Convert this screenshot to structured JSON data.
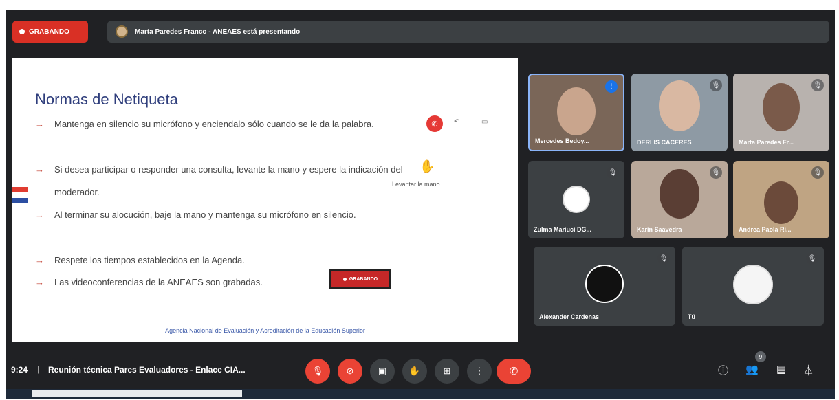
{
  "header": {
    "recording_label": "GRABANDO",
    "presenting_text": "Marta Paredes Franco - ANEAES está presentando"
  },
  "slide": {
    "title": "Normas de Netiqueta",
    "bullets": [
      "Mantenga en silencio su micrófono y enciendalo sólo cuando se le da la palabra.",
      "Si desea participar o responder una consulta, levante la mano y espere la indicación del moderador.",
      "Al terminar su alocución, baje la mano y mantenga su micrófono en silencio.",
      "Respete los tiempos establecidos en la Agenda.",
      "Las videoconferencias de la ANEAES son grabadas."
    ],
    "raise_hand_label": "Levantar la mano",
    "recording_label": "GRABANDO",
    "footer": "Agencia Nacional de Evaluación y Acreditación de la Educación Superior"
  },
  "participants": [
    {
      "name": "Mercedes Bedoy...",
      "speaking": true
    },
    {
      "name": "DERLIS CACERES",
      "speaking": false
    },
    {
      "name": "Marta Paredes Fr...",
      "speaking": false
    },
    {
      "name": "Zulma Mariuci DG...",
      "speaking": false
    },
    {
      "name": "Karin Saavedra",
      "speaking": false
    },
    {
      "name": "Andrea Paola Ri...",
      "speaking": false
    },
    {
      "name": "Alexander Cardenas",
      "speaking": false
    },
    {
      "name": "Tú",
      "speaking": false
    }
  ],
  "footer": {
    "time": "9:24",
    "meeting_title": "Reunión técnica Pares Evaluadores - Enlace CIA...",
    "people_count": "9"
  },
  "colors": {
    "background": "#202124",
    "tile": "#3c4043",
    "danger": "#ea4335",
    "accent": "#8ab4f8"
  },
  "icons": [
    "mic-off-icon",
    "camera-off-icon",
    "captions-icon",
    "raise-hand-icon",
    "present-icon",
    "more-icon",
    "hang-up-icon",
    "info-icon",
    "people-icon",
    "chat-icon",
    "activities-icon"
  ]
}
